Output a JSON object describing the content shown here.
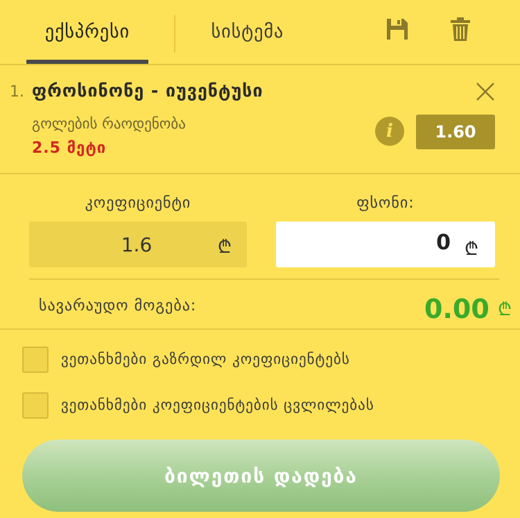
{
  "tabs": {
    "express": "ექსპრესი",
    "system": "სისტემა"
  },
  "icons": {
    "save": "floppy-disk-icon",
    "delete": "trash-icon",
    "close": "close-icon",
    "info": "info-icon"
  },
  "bet": {
    "index": "1.",
    "title": "ფროსინონე - იუვენტუსი",
    "market": "გოლების რაოდენობა",
    "selection": "2.5 მეტი",
    "odds": "1.60",
    "info_glyph": "i"
  },
  "coef": {
    "label": "კოეფიციენტი",
    "value": "1.6",
    "currency": "₾"
  },
  "stake": {
    "label": "ფსონი:",
    "value": "0",
    "currency": "₾"
  },
  "win": {
    "label": "სავარაუდო მოგება:",
    "value": "0.00",
    "currency": "₾"
  },
  "options": [
    {
      "label": "ვეთანხმები გაზრდილ კოეფიციენტებს",
      "checked": false
    },
    {
      "label": "ვეთანხმები კოეფიციენტების ცვლილებას",
      "checked": false
    }
  ],
  "submit_label": "ბილეთის დადება",
  "colors": {
    "background": "#fde257",
    "accent_dark": "#a8922a",
    "selection_red": "#d4261e",
    "win_green": "#3aaa2a"
  }
}
